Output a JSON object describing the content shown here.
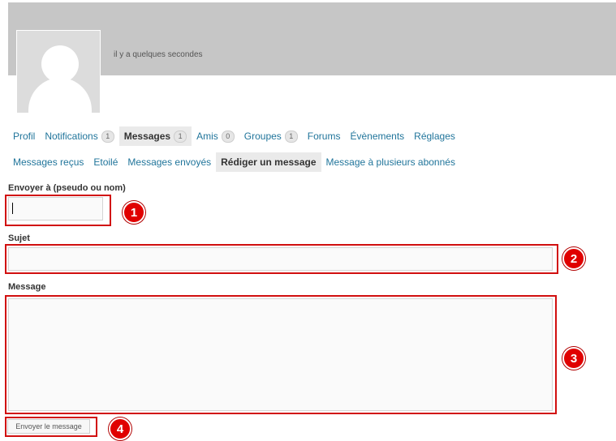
{
  "header": {
    "last_active": "il y a quelques secondes"
  },
  "nav_primary": [
    {
      "label": "Profil",
      "count": ""
    },
    {
      "label": "Notifications",
      "count": "1"
    },
    {
      "label": "Messages",
      "count": "1",
      "current": true
    },
    {
      "label": "Amis",
      "count": "0"
    },
    {
      "label": "Groupes",
      "count": "1"
    },
    {
      "label": "Forums",
      "count": ""
    },
    {
      "label": "Évènements",
      "count": ""
    },
    {
      "label": "Réglages",
      "count": ""
    }
  ],
  "nav_secondary": [
    {
      "label": "Messages reçus"
    },
    {
      "label": "Etoilé"
    },
    {
      "label": "Messages envoyés"
    },
    {
      "label": "Rédiger un message",
      "current": true
    },
    {
      "label": "Message à plusieurs abonnés"
    }
  ],
  "form": {
    "recipient_label": "Envoyer à (pseudo ou nom)",
    "recipient_value": "",
    "subject_label": "Sujet",
    "subject_value": "",
    "message_label": "Message",
    "message_value": "",
    "submit_label": "Envoyer le message"
  },
  "annotations": [
    "1",
    "2",
    "3",
    "4"
  ],
  "colors": {
    "link": "#21759b",
    "highlight": "#d10f0f",
    "cover": "#c6c6c6"
  }
}
